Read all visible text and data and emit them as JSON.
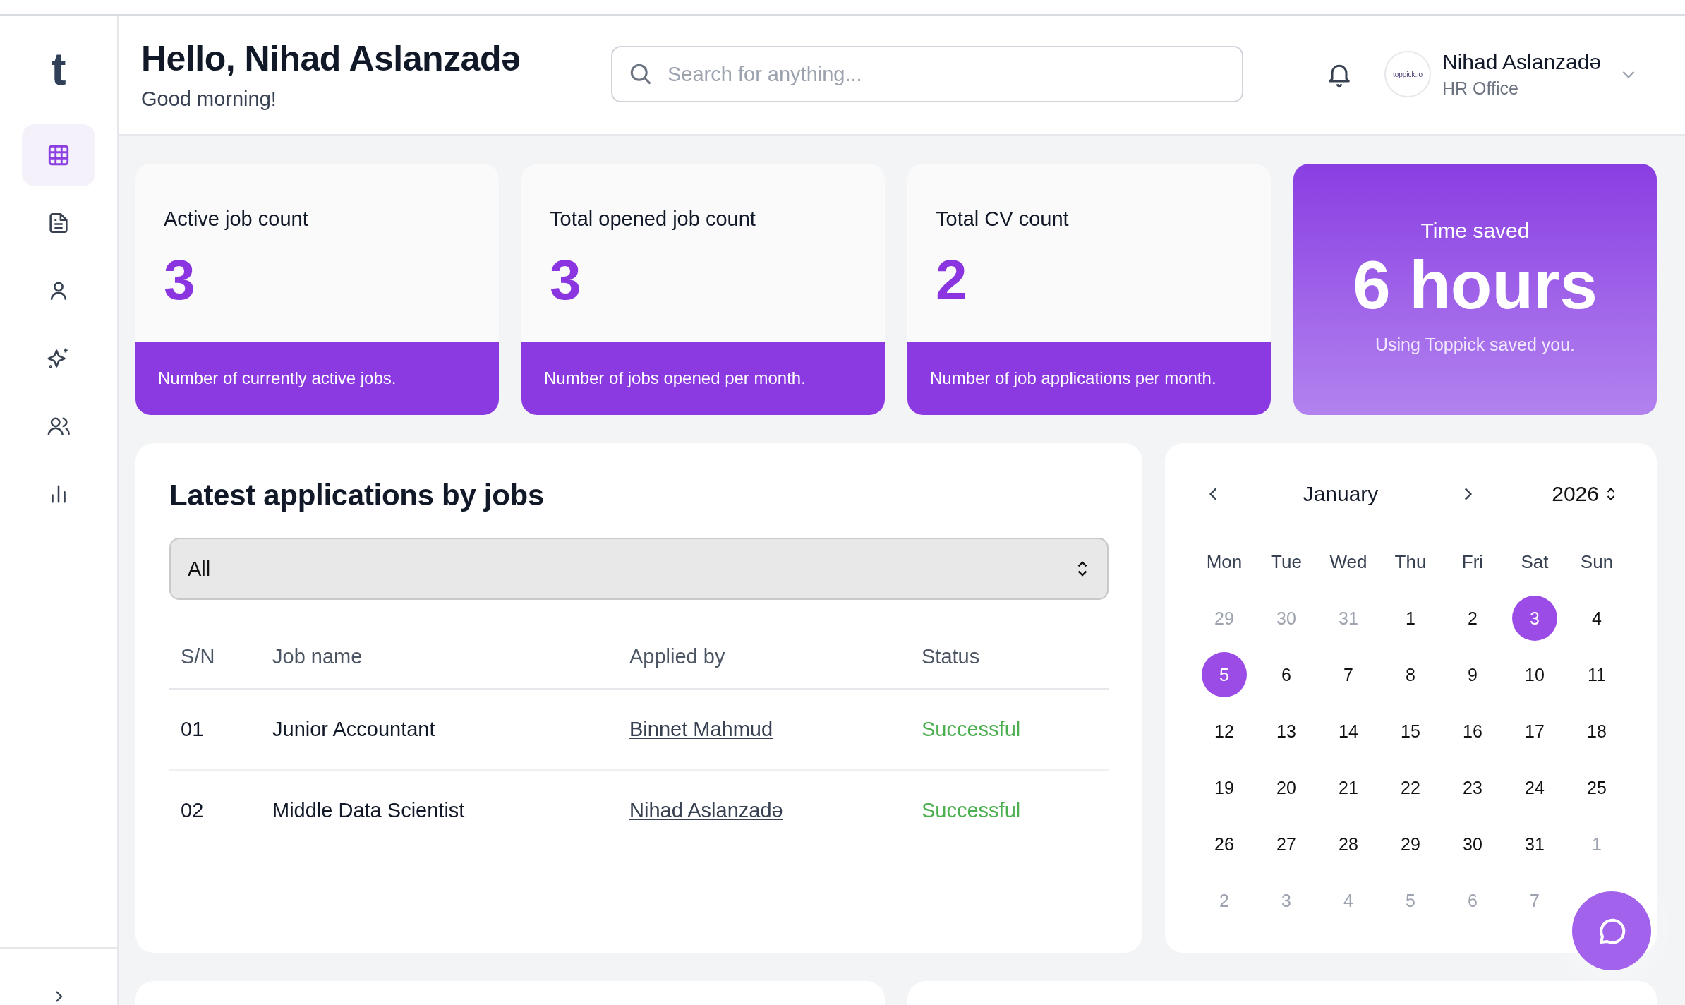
{
  "sidebar": {
    "logo": "t",
    "items": [
      {
        "kind": "grid",
        "selected": true
      },
      {
        "kind": "document",
        "selected": false
      },
      {
        "kind": "user",
        "selected": false
      },
      {
        "kind": "sparkle",
        "selected": false
      },
      {
        "kind": "users",
        "selected": false
      },
      {
        "kind": "chart",
        "selected": false
      }
    ]
  },
  "header": {
    "greeting": "Hello, Nihad Aslanzadə",
    "subtitle": "Good morning!",
    "search": {
      "placeholder": "Search for anything..."
    },
    "user": {
      "name": "Nihad Aslanzadə",
      "role": "HR Office",
      "avatar_text": "toppick.io"
    }
  },
  "stats": [
    {
      "label": "Active job count",
      "value": "3",
      "note": "Number of currently active jobs."
    },
    {
      "label": "Total opened job count",
      "value": "3",
      "note": "Number of jobs opened per month."
    },
    {
      "label": "Total CV count",
      "value": "2",
      "note": "Number of job applications per month."
    }
  ],
  "time_saved": {
    "label": "Time saved",
    "value": "6 hours",
    "note": "Using Toppick saved you."
  },
  "applications": {
    "title": "Latest applications by jobs",
    "filter": {
      "value": "All"
    },
    "columns": [
      "S/N",
      "Job name",
      "Applied by",
      "Status"
    ],
    "rows": [
      {
        "sn": "01",
        "job": "Junior Accountant",
        "applicant": "Binnet Mahmud",
        "status": "Successful"
      },
      {
        "sn": "02",
        "job": "Middle Data Scientist",
        "applicant": "Nihad Aslanzadə",
        "status": "Successful"
      }
    ]
  },
  "calendar": {
    "month": "January",
    "year": "2026",
    "weekdays": [
      "Mon",
      "Tue",
      "Wed",
      "Thu",
      "Fri",
      "Sat",
      "Sun"
    ],
    "weeks": [
      [
        {
          "d": "29",
          "outside": true,
          "selected": false
        },
        {
          "d": "30",
          "outside": true,
          "selected": false
        },
        {
          "d": "31",
          "outside": true,
          "selected": false
        },
        {
          "d": "1",
          "outside": false,
          "selected": false
        },
        {
          "d": "2",
          "outside": false,
          "selected": false
        },
        {
          "d": "3",
          "outside": false,
          "selected": true
        },
        {
          "d": "4",
          "outside": false,
          "selected": false
        }
      ],
      [
        {
          "d": "5",
          "outside": false,
          "selected": true
        },
        {
          "d": "6",
          "outside": false,
          "selected": false
        },
        {
          "d": "7",
          "outside": false,
          "selected": false
        },
        {
          "d": "8",
          "outside": false,
          "selected": false
        },
        {
          "d": "9",
          "outside": false,
          "selected": false
        },
        {
          "d": "10",
          "outside": false,
          "selected": false
        },
        {
          "d": "11",
          "outside": false,
          "selected": false
        }
      ],
      [
        {
          "d": "12",
          "outside": false,
          "selected": false
        },
        {
          "d": "13",
          "outside": false,
          "selected": false
        },
        {
          "d": "14",
          "outside": false,
          "selected": false
        },
        {
          "d": "15",
          "outside": false,
          "selected": false
        },
        {
          "d": "16",
          "outside": false,
          "selected": false
        },
        {
          "d": "17",
          "outside": false,
          "selected": false
        },
        {
          "d": "18",
          "outside": false,
          "selected": false
        }
      ],
      [
        {
          "d": "19",
          "outside": false,
          "selected": false
        },
        {
          "d": "20",
          "outside": false,
          "selected": false
        },
        {
          "d": "21",
          "outside": false,
          "selected": false
        },
        {
          "d": "22",
          "outside": false,
          "selected": false
        },
        {
          "d": "23",
          "outside": false,
          "selected": false
        },
        {
          "d": "24",
          "outside": false,
          "selected": false
        },
        {
          "d": "25",
          "outside": false,
          "selected": false
        }
      ],
      [
        {
          "d": "26",
          "outside": false,
          "selected": false
        },
        {
          "d": "27",
          "outside": false,
          "selected": false
        },
        {
          "d": "28",
          "outside": false,
          "selected": false
        },
        {
          "d": "29",
          "outside": false,
          "selected": false
        },
        {
          "d": "30",
          "outside": false,
          "selected": false
        },
        {
          "d": "31",
          "outside": false,
          "selected": false
        },
        {
          "d": "1",
          "outside": true,
          "selected": false
        }
      ],
      [
        {
          "d": "2",
          "outside": true,
          "selected": false
        },
        {
          "d": "3",
          "outside": true,
          "selected": false
        },
        {
          "d": "4",
          "outside": true,
          "selected": false
        },
        {
          "d": "5",
          "outside": true,
          "selected": false
        },
        {
          "d": "6",
          "outside": true,
          "selected": false
        },
        {
          "d": "7",
          "outside": true,
          "selected": false
        }
      ]
    ]
  }
}
